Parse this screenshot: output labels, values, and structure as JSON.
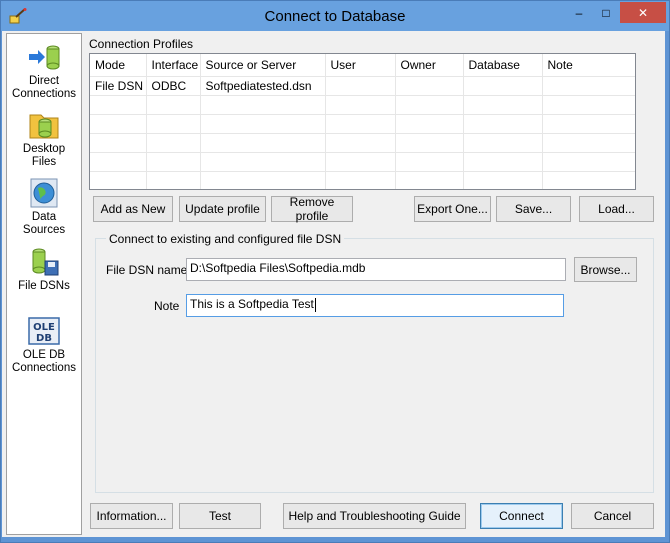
{
  "window": {
    "title": "Connect to Database",
    "minimize_glyph": "–",
    "maximize_glyph": "□",
    "close_glyph": "✕"
  },
  "sidebar": {
    "items": [
      {
        "label_line1": "Direct",
        "label_line2": "Connections",
        "icon": "direct-connections-icon"
      },
      {
        "label_line1": "Desktop",
        "label_line2": "Files",
        "icon": "desktop-files-icon"
      },
      {
        "label_line1": "Data",
        "label_line2": "Sources",
        "icon": "data-sources-icon"
      },
      {
        "label_line1": "File DSNs",
        "label_line2": "",
        "icon": "file-dsns-icon"
      },
      {
        "label_line1": "OLE DB",
        "label_line2": "Connections",
        "icon": "ole-db-icon"
      }
    ]
  },
  "profiles": {
    "title": "Connection Profiles",
    "columns": [
      "Mode",
      "Interface",
      "Source or Server",
      "User",
      "Owner",
      "Database",
      "Note"
    ],
    "rows": [
      [
        "File DSN",
        "ODBC",
        "Softpediatested.dsn",
        "",
        "",
        "",
        ""
      ]
    ],
    "buttons": {
      "add_new": "Add as New",
      "update": "Update profile",
      "remove": "Remove profile",
      "export": "Export One...",
      "save": "Save...",
      "load": "Load..."
    }
  },
  "dsn_group": {
    "title": "Connect to existing and configured file DSN",
    "file_dsn_label": "File DSN name",
    "file_dsn_value": "D:\\Softpedia Files\\Softpedia.mdb",
    "browse": "Browse...",
    "note_label": "Note",
    "note_value": "This is a Softpedia Test"
  },
  "footer": {
    "information": "Information...",
    "test": "Test",
    "help": "Help and Troubleshooting Guide",
    "connect": "Connect",
    "cancel": "Cancel"
  },
  "colors": {
    "titlebar": "#68a1df",
    "close_button": "#c74f45",
    "default_button_border": "#3c7fb1"
  }
}
